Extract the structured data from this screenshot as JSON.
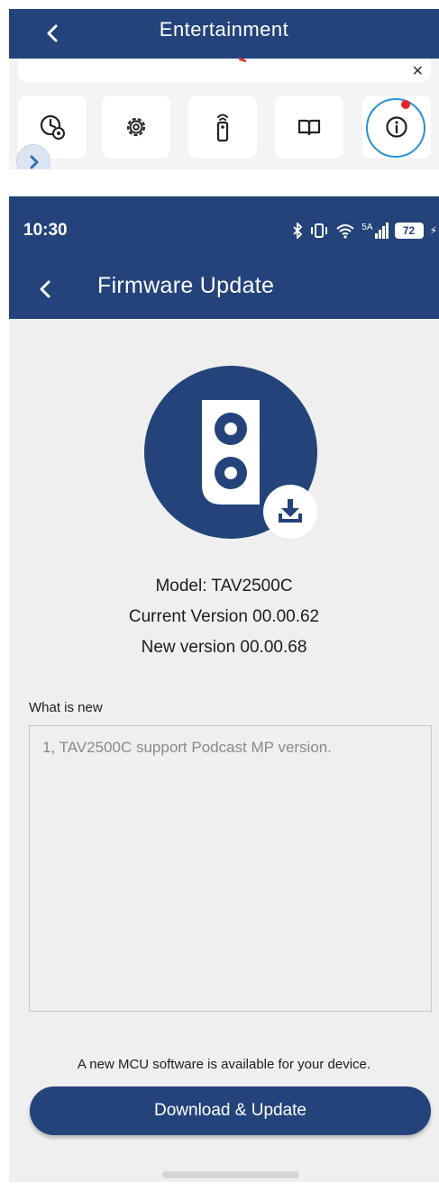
{
  "snippet": {
    "title": "Entertainment",
    "tiles": [
      "timer-settings-icon",
      "gear-icon",
      "remote-icon",
      "book-icon",
      "info-icon"
    ]
  },
  "status_bar": {
    "time": "10:30",
    "network_label": "5A",
    "battery": "72"
  },
  "app_bar": {
    "title": "Firmware Update"
  },
  "device": {
    "model": "Model: TAV2500C",
    "current_version": "Current Version 00.00.62",
    "new_version": "New version 00.00.68"
  },
  "whats_new": {
    "label": "What is new",
    "text": "1, TAV2500C support Podcast MP version."
  },
  "footer": {
    "message": "A new MCU software is available for your device.",
    "button_label": "Download & Update"
  },
  "colors": {
    "primary": "#23437a",
    "highlight_ring": "#2f8fd6",
    "notification": "#e2232a",
    "background": "#efefef"
  }
}
